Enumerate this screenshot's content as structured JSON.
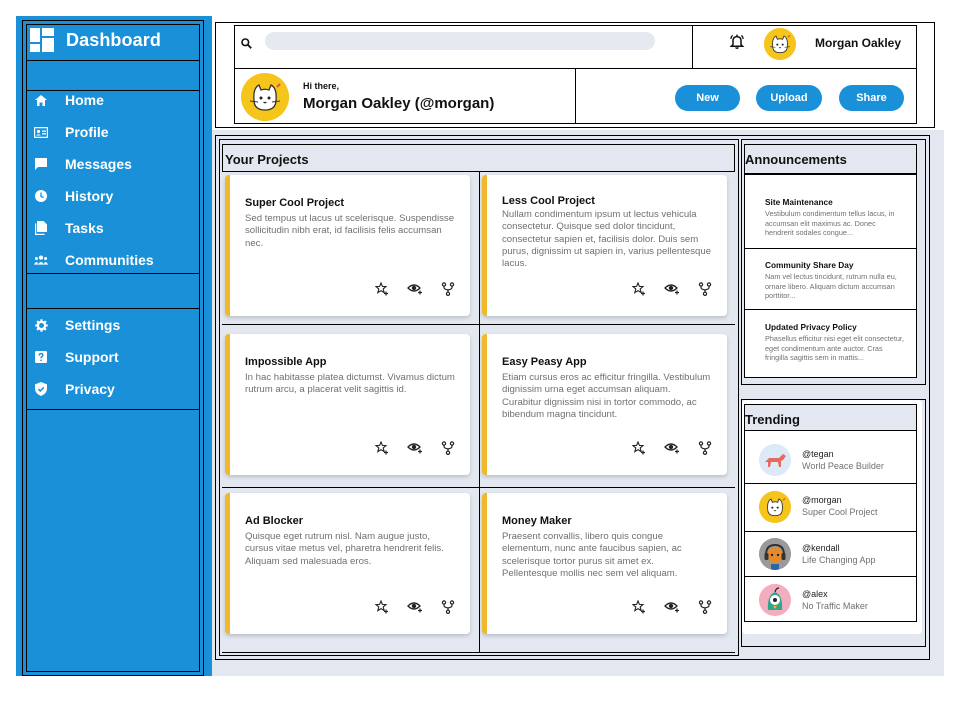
{
  "colors": {
    "brand": "#1a90d8",
    "accent": "#f0b92b",
    "background": "#e3e8f0",
    "muted_text": "#707070"
  },
  "sidebar": {
    "brand": "Dashboard",
    "brand_icon": "grid-icon",
    "items": [
      {
        "label": "Home",
        "icon": "home-icon"
      },
      {
        "label": "Profile",
        "icon": "profile-card-icon"
      },
      {
        "label": "Messages",
        "icon": "message-icon"
      },
      {
        "label": "History",
        "icon": "clock-icon"
      },
      {
        "label": "Tasks",
        "icon": "document-icon"
      },
      {
        "label": "Communities",
        "icon": "group-icon"
      },
      {
        "label": "Settings",
        "icon": "gear-icon"
      },
      {
        "label": "Support",
        "icon": "help-icon"
      },
      {
        "label": "Privacy",
        "icon": "shield-icon"
      }
    ]
  },
  "header": {
    "search_placeholder": "",
    "user_name": "Morgan Oakley",
    "greeting": "Hi there,",
    "full_name": "Morgan Oakley (@morgan)",
    "buttons": {
      "new": "New",
      "upload": "Upload",
      "share": "Share"
    }
  },
  "projects": {
    "title": "Your Projects",
    "items": [
      {
        "title": "Super Cool Project",
        "description": "Sed tempus ut lacus ut scelerisque. Suspendisse sollicitudin nibh erat, id facilisis felis accumsan nec."
      },
      {
        "title": "Less Cool Project",
        "description": "Nullam condimentum ipsum ut lectus vehicula consectetur. Quisque sed dolor tincidunt, consectetur sapien et, facilisis dolor. Duis sem purus, dignissim ut sapien in, varius pellentesque lacus."
      },
      {
        "title": "Impossible App",
        "description": "In hac habitasse platea dictumst. Vivamus dictum rutrum arcu, a placerat velit sagittis id."
      },
      {
        "title": "Easy Peasy App",
        "description": "Etiam cursus eros ac efficitur fringilla. Vestibulum dignissim urna eget accumsan aliquam. Curabitur dignissim nisi in tortor commodo, ac bibendum magna tincidunt."
      },
      {
        "title": "Ad Blocker",
        "description": "Quisque eget rutrum nisl. Nam augue justo, cursus vitae metus vel, pharetra hendrerit felis. Aliquam sed malesuada eros."
      },
      {
        "title": "Money Maker",
        "description": "Praesent convallis, libero quis congue elementum, nunc ante faucibus sapien, ac scelerisque tortor purus sit amet ex. Pellentesque mollis nec sem vel aliquam."
      }
    ],
    "action_icons": [
      "star-plus-icon",
      "watch-icon",
      "fork-icon"
    ]
  },
  "announcements": {
    "title": "Announcements",
    "items": [
      {
        "title": "Site Maintenance",
        "text": "Vestibulum condimentum tellus lacus, in accumsan elit maximus ac. Donec hendrerit sodales congue..."
      },
      {
        "title": "Community Share Day",
        "text": "Nam vel lectus tincidunt, rutrum nulla eu, ornare libero. Aliquam dictum accumsan porttitor..."
      },
      {
        "title": "Updated Privacy Policy",
        "text": "Phasellus efficitur nisi eget elit consectetur, eget condimentum ante auctor. Cras fringilla sagittis sem in mattis..."
      }
    ]
  },
  "trending": {
    "title": "Trending",
    "items": [
      {
        "handle": "@tegan",
        "subtitle": "World Peace Builder",
        "avatar": "dog-avatar"
      },
      {
        "handle": "@morgan",
        "subtitle": "Super Cool Project",
        "avatar": "cat-avatar"
      },
      {
        "handle": "@kendall",
        "subtitle": "Life Changing App",
        "avatar": "headphones-avatar"
      },
      {
        "handle": "@alex",
        "subtitle": "No Traffic Maker",
        "avatar": "bird-avatar"
      }
    ]
  }
}
